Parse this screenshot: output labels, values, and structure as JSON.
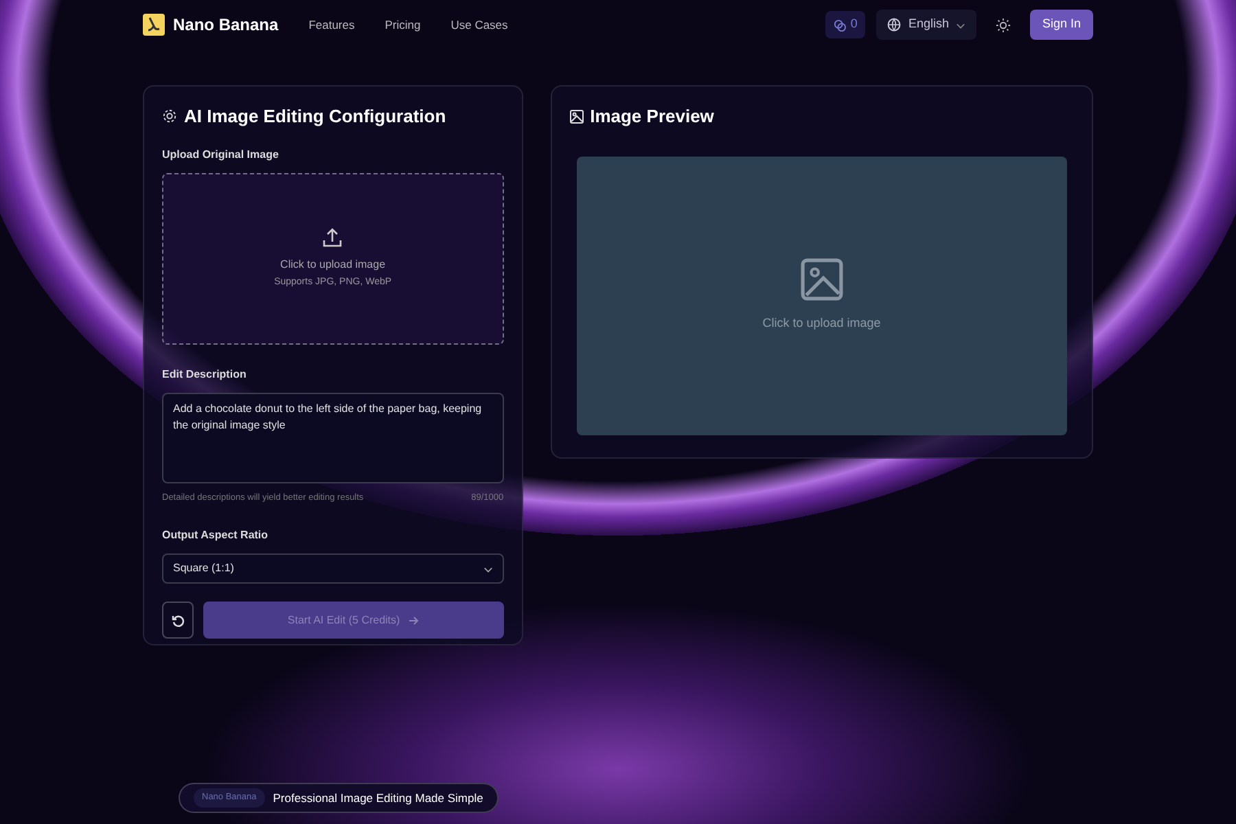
{
  "nav": {
    "brand": "Nano Banana",
    "links": [
      "Features",
      "Pricing",
      "Use Cases"
    ],
    "credits": "0",
    "language": "English",
    "sign_in": "Sign In"
  },
  "config": {
    "title": "AI Image Editing Configuration",
    "upload_label": "Upload Original Image",
    "upload_text": "Click to upload image",
    "upload_hint": "Supports JPG, PNG, WebP",
    "description_label": "Edit Description",
    "description_value": "Add a chocolate donut to the left side of the paper bag, keeping the original image style",
    "description_hint": "Detailed descriptions will yield better editing results",
    "char_count": "89/1000",
    "ratio_label": "Output Aspect Ratio",
    "ratio_value": "Square (1:1)",
    "start_button": {
      "label": "Start AI Edit (5 Credits)",
      "disabled": true
    }
  },
  "preview": {
    "title": "Image Preview",
    "placeholder": "Click to upload image"
  },
  "footer_pill": {
    "badge": "Nano Banana",
    "text": "Professional Image Editing Made Simple"
  }
}
